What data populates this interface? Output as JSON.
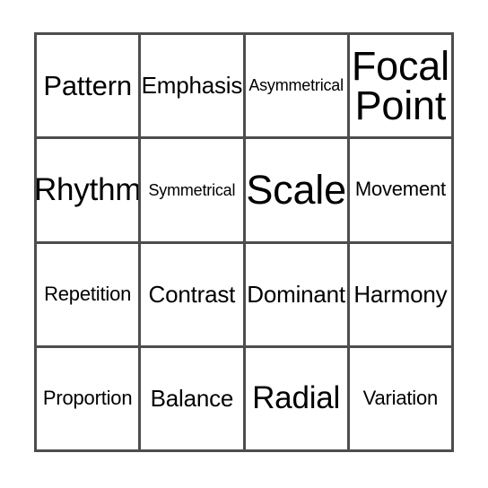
{
  "card": {
    "type": "bingo-card",
    "rows": 4,
    "columns": 4,
    "border_color": "#4d4d4d",
    "cell_background": "#ffffff",
    "text_color": "#000000",
    "cells": [
      {
        "label": "Pattern",
        "row": 1,
        "col": 1,
        "size": "lg"
      },
      {
        "label": "Emphasis",
        "row": 1,
        "col": 2,
        "size": "md"
      },
      {
        "label": "Asymmetrical",
        "row": 1,
        "col": 3,
        "size": "xs"
      },
      {
        "label": "Focal\nPoint",
        "row": 1,
        "col": 4,
        "size": "xxl"
      },
      {
        "label": "Rhythm",
        "row": 2,
        "col": 1,
        "size": "xl"
      },
      {
        "label": "Symmetrical",
        "row": 2,
        "col": 2,
        "size": "xs"
      },
      {
        "label": "Scale",
        "row": 2,
        "col": 3,
        "size": "xxl"
      },
      {
        "label": "Movement",
        "row": 2,
        "col": 4,
        "size": "sm"
      },
      {
        "label": "Repetition",
        "row": 3,
        "col": 1,
        "size": "sm"
      },
      {
        "label": "Contrast",
        "row": 3,
        "col": 2,
        "size": "md"
      },
      {
        "label": "Dominant",
        "row": 3,
        "col": 3,
        "size": "md"
      },
      {
        "label": "Harmony",
        "row": 3,
        "col": 4,
        "size": "md"
      },
      {
        "label": "Proportion",
        "row": 4,
        "col": 1,
        "size": "sm"
      },
      {
        "label": "Balance",
        "row": 4,
        "col": 2,
        "size": "md"
      },
      {
        "label": "Radial",
        "row": 4,
        "col": 3,
        "size": "xl"
      },
      {
        "label": "Variation",
        "row": 4,
        "col": 4,
        "size": "sm"
      }
    ]
  }
}
